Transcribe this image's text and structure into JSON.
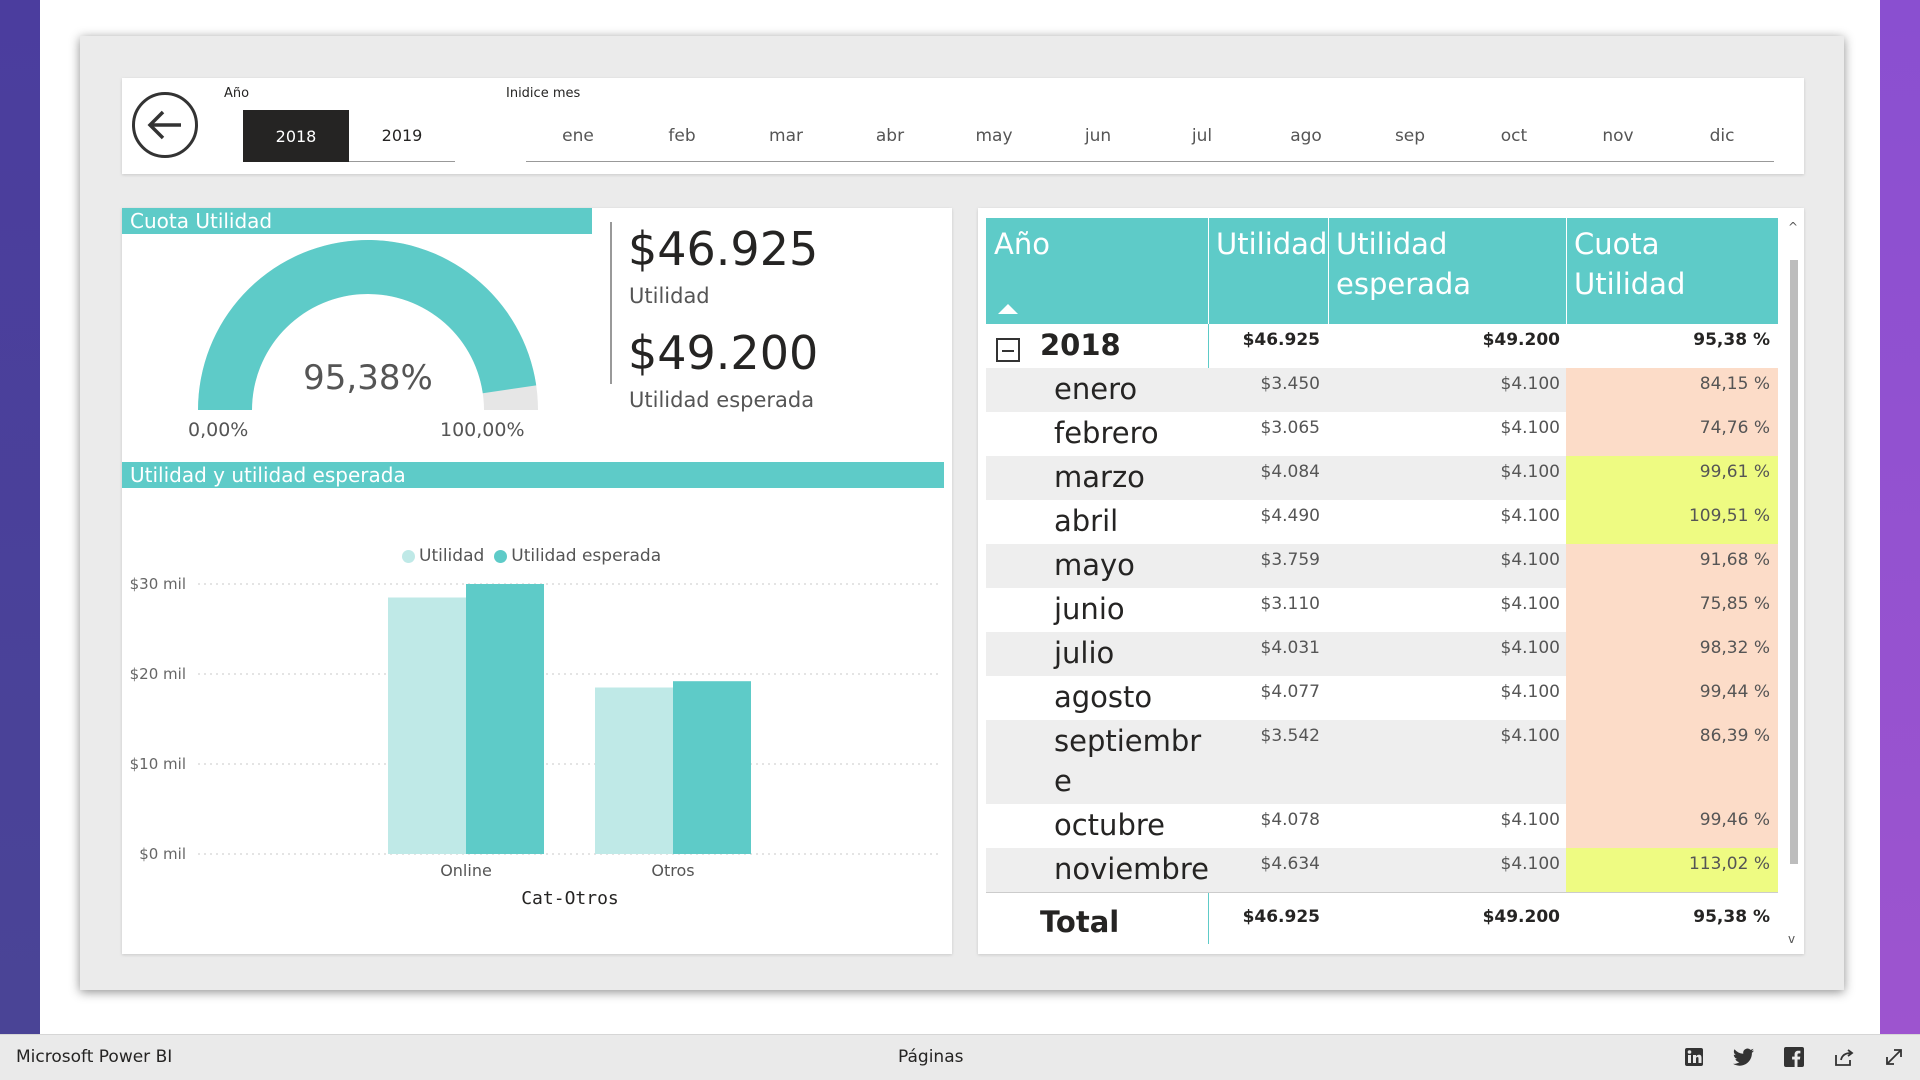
{
  "filters": {
    "year_title": "Año",
    "years": [
      {
        "label": "2018",
        "selected": true
      },
      {
        "label": "2019",
        "selected": false
      }
    ],
    "month_title": "Inidice mes",
    "months": [
      "ene",
      "feb",
      "mar",
      "abr",
      "may",
      "jun",
      "jul",
      "ago",
      "sep",
      "oct",
      "nov",
      "dic"
    ]
  },
  "gauge": {
    "title": "Cuota Utilidad",
    "value_text": "95,38%",
    "value": 0.9538,
    "min_label": "0,00%",
    "max_label": "100,00%",
    "color": "#5ecbc8"
  },
  "kpis": [
    {
      "value": "$46.925",
      "label": "Utilidad"
    },
    {
      "value": "$49.200",
      "label": "Utilidad esperada"
    }
  ],
  "chart_title": "Utilidad y utilidad esperada",
  "chart_data": {
    "type": "bar",
    "categories": [
      "Online",
      "Otros"
    ],
    "series": [
      {
        "name": "Utilidad",
        "values": [
          28500,
          18500
        ],
        "color": "#bfe9e7"
      },
      {
        "name": "Utilidad esperada",
        "values": [
          30000,
          19200
        ],
        "color": "#5ecbc8"
      }
    ],
    "xlabel": "Cat-Otros",
    "ylabel": "",
    "ylim": [
      0,
      30000
    ],
    "yticks": [
      {
        "value": 30000,
        "label": "$30 mil"
      },
      {
        "value": 20000,
        "label": "$20 mil"
      },
      {
        "value": 10000,
        "label": "$10 mil"
      },
      {
        "value": 0,
        "label": "$0 mil"
      }
    ],
    "legend_position": "top-center",
    "grid": true
  },
  "table": {
    "headers": {
      "year": "Año",
      "util": "Utilidad",
      "esp": "Utilidad esperada",
      "cuota": "Cuota Utilidad"
    },
    "year_row": {
      "name": "2018",
      "util": "$46.925",
      "esp": "$49.200",
      "cuota": "95,38 %"
    },
    "rows": [
      {
        "name": "enero",
        "util": "$3.450",
        "esp": "$4.100",
        "cuota": "84,15 %",
        "color": "#fcdcc8"
      },
      {
        "name": "febrero",
        "util": "$3.065",
        "esp": "$4.100",
        "cuota": "74,76 %",
        "color": "#fcdcc8"
      },
      {
        "name": "marzo",
        "util": "$4.084",
        "esp": "$4.100",
        "cuota": "99,61 %",
        "color": "#eefb82"
      },
      {
        "name": "abril",
        "util": "$4.490",
        "esp": "$4.100",
        "cuota": "109,51 %",
        "color": "#eefb82"
      },
      {
        "name": "mayo",
        "util": "$3.759",
        "esp": "$4.100",
        "cuota": "91,68 %",
        "color": "#fcdcc8"
      },
      {
        "name": "junio",
        "util": "$3.110",
        "esp": "$4.100",
        "cuota": "75,85 %",
        "color": "#fcdcc8"
      },
      {
        "name": "julio",
        "util": "$4.031",
        "esp": "$4.100",
        "cuota": "98,32 %",
        "color": "#fcdcc8"
      },
      {
        "name": "agosto",
        "util": "$4.077",
        "esp": "$4.100",
        "cuota": "99,44 %",
        "color": "#fcdcc8"
      },
      {
        "name": "septiembr",
        "name2": "e",
        "util": "$3.542",
        "esp": "$4.100",
        "cuota": "86,39 %",
        "color": "#fcdcc8"
      },
      {
        "name": "octubre",
        "util": "$4.078",
        "esp": "$4.100",
        "cuota": "99,46 %",
        "color": "#fcdcc8"
      },
      {
        "name": "noviembre",
        "util": "$4.634",
        "esp": "$4.100",
        "cuota": "113,02 %",
        "color": "#eefb82"
      }
    ],
    "total": {
      "name": "Total",
      "util": "$46.925",
      "esp": "$49.200",
      "cuota": "95,38 %"
    }
  },
  "bottom_bar": {
    "brand": "Microsoft Power BI",
    "pages": "Páginas",
    "icons": [
      "linkedin-icon",
      "twitter-icon",
      "facebook-icon",
      "share-icon",
      "expand-icon"
    ]
  }
}
